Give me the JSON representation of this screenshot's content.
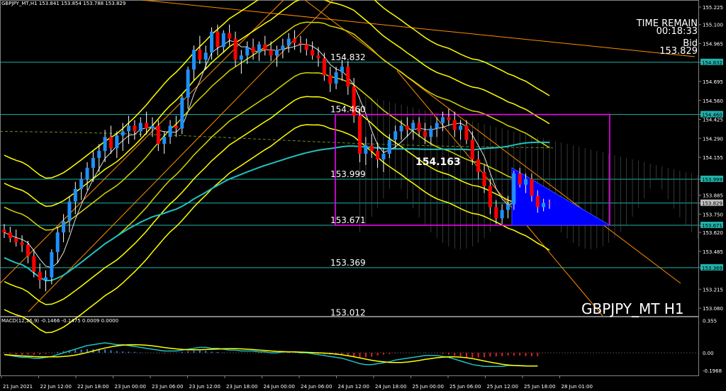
{
  "header": {
    "info": "GBPJPY_MT,H1  153.841 153.854 153.788 153.829",
    "time_remain_label": "TIME REMAIN",
    "time_remain": "00:18:33",
    "bid_label": "Bid",
    "bid": "153.829",
    "symbol": "GBPJPY_MT H1",
    "macd_info": "MACD(12,26,9) -0.1466 -0.1475 0.0009 0.0000",
    "big_label": "154.163"
  },
  "colors": {
    "background": "#000000",
    "bull": "#1e90ff",
    "bear": "#ff0000",
    "band": "#ffff00",
    "ma_cyan": "#20c0c0",
    "trend": "#ff8c00",
    "box": "#ff00ff",
    "triangle": "#0000ff",
    "hline": "#20b2aa"
  },
  "chart_data": {
    "type": "candlestick",
    "title": "GBPJPY_MT H1",
    "ylim": [
      153.0,
      155.25
    ],
    "y_ticks": [
      "155.225",
      "155.100",
      "154.965",
      "154.832",
      "154.695",
      "154.560",
      "154.460",
      "154.425",
      "154.290",
      "154.155",
      "153.999",
      "153.885",
      "153.829",
      "153.750",
      "153.671",
      "153.620",
      "153.485",
      "153.369",
      "153.215",
      "153.080"
    ],
    "x_ticks": [
      "21 Jun 2021",
      "22 Jun 12:00",
      "22 Jun 18:00",
      "23 Jun 00:00",
      "23 Jun 06:00",
      "23 Jun 12:00",
      "23 Jun 18:00",
      "24 Jun 00:00",
      "24 Jun 06:00",
      "24 Jun 12:00",
      "24 Jun 18:00",
      "25 Jun 00:00",
      "25 Jun 06:00",
      "25 Jun 12:00",
      "25 Jun 18:00",
      "28 Jun 01:00"
    ],
    "level_labels": [
      "154.832",
      "154.460",
      "153.999",
      "153.671",
      "153.369",
      "153.012"
    ],
    "highlighted_levels": [
      "154.832",
      "154.460",
      "153.999",
      "153.829",
      "153.671",
      "153.369"
    ],
    "candles": [
      [
        153.64,
        153.68,
        153.58,
        153.62
      ],
      [
        153.62,
        153.66,
        153.55,
        153.58
      ],
      [
        153.58,
        153.64,
        153.52,
        153.55
      ],
      [
        153.55,
        153.6,
        153.48,
        153.53
      ],
      [
        153.53,
        153.56,
        153.4,
        153.45
      ],
      [
        153.45,
        153.5,
        153.3,
        153.34
      ],
      [
        153.34,
        153.4,
        153.22,
        153.28
      ],
      [
        153.28,
        153.35,
        153.2,
        153.3
      ],
      [
        153.3,
        153.5,
        153.25,
        153.48
      ],
      [
        153.48,
        153.66,
        153.4,
        153.62
      ],
      [
        153.62,
        153.75,
        153.55,
        153.7
      ],
      [
        153.7,
        153.88,
        153.62,
        153.84
      ],
      [
        153.84,
        153.98,
        153.75,
        153.93
      ],
      [
        153.93,
        154.05,
        153.85,
        154.0
      ],
      [
        154.0,
        154.12,
        153.92,
        154.08
      ],
      [
        154.08,
        154.2,
        153.98,
        154.15
      ],
      [
        154.15,
        154.25,
        154.05,
        154.2
      ],
      [
        154.2,
        154.35,
        154.12,
        154.3
      ],
      [
        154.3,
        154.38,
        154.18,
        154.22
      ],
      [
        154.22,
        154.34,
        154.15,
        154.31
      ],
      [
        154.31,
        154.4,
        154.2,
        154.34
      ],
      [
        154.34,
        154.45,
        154.25,
        154.38
      ],
      [
        154.38,
        154.42,
        154.28,
        154.34
      ],
      [
        154.34,
        154.44,
        154.3,
        154.4
      ],
      [
        154.4,
        154.48,
        154.32,
        154.36
      ],
      [
        154.36,
        154.44,
        154.3,
        154.38
      ],
      [
        154.38,
        154.42,
        154.2,
        154.25
      ],
      [
        154.25,
        154.34,
        154.18,
        154.3
      ],
      [
        154.3,
        154.42,
        154.25,
        154.38
      ],
      [
        154.38,
        154.45,
        154.3,
        154.36
      ],
      [
        154.36,
        154.6,
        154.32,
        154.58
      ],
      [
        154.58,
        154.8,
        154.5,
        154.78
      ],
      [
        154.78,
        154.95,
        154.7,
        154.92
      ],
      [
        154.92,
        155.02,
        154.82,
        154.85
      ],
      [
        154.85,
        154.95,
        154.78,
        154.9
      ],
      [
        154.9,
        155.08,
        154.85,
        155.05
      ],
      [
        155.05,
        155.1,
        154.88,
        154.94
      ],
      [
        154.94,
        155.06,
        154.9,
        155.04
      ],
      [
        155.04,
        155.1,
        154.95,
        155.0
      ],
      [
        155.0,
        155.05,
        154.8,
        154.85
      ],
      [
        154.85,
        154.92,
        154.75,
        154.88
      ],
      [
        154.88,
        154.98,
        154.82,
        154.94
      ],
      [
        154.94,
        155.0,
        154.85,
        154.9
      ],
      [
        154.9,
        154.98,
        154.84,
        154.96
      ],
      [
        154.96,
        155.02,
        154.88,
        154.92
      ],
      [
        154.92,
        154.98,
        154.84,
        154.88
      ],
      [
        154.88,
        154.95,
        154.8,
        154.92
      ],
      [
        154.92,
        155.0,
        154.86,
        154.95
      ],
      [
        154.95,
        155.04,
        154.9,
        155.0
      ],
      [
        155.0,
        155.06,
        154.92,
        154.97
      ],
      [
        154.97,
        155.02,
        154.9,
        154.96
      ],
      [
        154.96,
        155.0,
        154.88,
        154.92
      ],
      [
        154.92,
        154.98,
        154.85,
        154.88
      ],
      [
        154.88,
        154.94,
        154.8,
        154.86
      ],
      [
        154.86,
        154.9,
        154.7,
        154.74
      ],
      [
        154.74,
        154.8,
        154.62,
        154.68
      ],
      [
        154.68,
        154.8,
        154.64,
        154.76
      ],
      [
        154.76,
        154.85,
        154.7,
        154.8
      ],
      [
        154.8,
        154.84,
        154.6,
        154.66
      ],
      [
        154.66,
        154.72,
        154.4,
        154.45
      ],
      [
        154.45,
        154.5,
        154.12,
        154.18
      ],
      [
        154.18,
        154.3,
        154.1,
        154.24
      ],
      [
        154.24,
        154.32,
        154.15,
        154.2
      ],
      [
        154.2,
        154.26,
        154.08,
        154.14
      ],
      [
        154.14,
        154.22,
        154.05,
        154.18
      ],
      [
        154.18,
        154.32,
        154.15,
        154.28
      ],
      [
        154.28,
        154.38,
        154.22,
        154.34
      ],
      [
        154.34,
        154.42,
        154.28,
        154.38
      ],
      [
        154.38,
        154.44,
        154.3,
        154.35
      ],
      [
        154.35,
        154.42,
        154.28,
        154.4
      ],
      [
        154.4,
        154.44,
        154.3,
        154.34
      ],
      [
        154.34,
        154.4,
        154.25,
        154.3
      ],
      [
        154.3,
        154.38,
        154.24,
        154.36
      ],
      [
        154.36,
        154.44,
        154.3,
        154.4
      ],
      [
        154.4,
        154.48,
        154.34,
        154.44
      ],
      [
        154.44,
        154.5,
        154.38,
        154.42
      ],
      [
        154.42,
        154.48,
        154.3,
        154.35
      ],
      [
        154.35,
        154.42,
        154.28,
        154.38
      ],
      [
        154.38,
        154.42,
        154.25,
        154.28
      ],
      [
        154.28,
        154.34,
        154.1,
        154.14
      ],
      [
        154.14,
        154.2,
        154.0,
        154.05
      ],
      [
        154.05,
        154.1,
        153.9,
        153.95
      ],
      [
        153.95,
        154.0,
        153.75,
        153.8
      ],
      [
        153.8,
        153.85,
        153.68,
        153.72
      ],
      [
        153.72,
        153.82,
        153.68,
        153.78
      ],
      [
        153.78,
        153.88,
        153.72,
        153.82
      ],
      [
        153.82,
        154.06,
        153.78,
        154.04
      ],
      [
        154.04,
        154.08,
        153.94,
        153.96
      ],
      [
        153.96,
        154.04,
        153.9,
        154.0
      ],
      [
        154.0,
        154.04,
        153.84,
        153.88
      ],
      [
        153.88,
        153.92,
        153.76,
        153.8
      ],
      [
        153.8,
        153.86,
        153.77,
        153.83
      ],
      [
        153.83,
        153.854,
        153.788,
        153.829
      ]
    ],
    "macd": {
      "label": "MACD(12,26,9)",
      "ylim": [
        -0.25,
        0.4
      ],
      "y_ticks": [
        "0.355",
        "0.00",
        "-0.1968"
      ],
      "values": [
        -0.02,
        -0.03,
        -0.04,
        -0.05,
        -0.05,
        -0.06,
        -0.06,
        -0.05,
        -0.04,
        -0.02,
        0.0,
        0.02,
        0.04,
        0.06,
        0.08,
        0.09,
        0.1,
        0.11,
        0.1,
        0.09,
        0.09,
        0.08,
        0.07,
        0.06,
        0.05,
        0.04,
        0.03,
        0.02,
        0.02,
        0.02,
        0.03,
        0.04,
        0.05,
        0.06,
        0.06,
        0.05,
        0.05,
        0.04,
        0.03,
        0.03,
        0.02,
        0.02,
        0.02,
        0.01,
        0.01,
        0.0,
        0.0,
        0.01,
        0.01,
        0.01,
        0.0,
        0.0,
        -0.01,
        -0.02,
        -0.03,
        -0.04,
        -0.05,
        -0.06,
        -0.08,
        -0.1,
        -0.12,
        -0.13,
        -0.13,
        -0.12,
        -0.11,
        -0.1,
        -0.08,
        -0.07,
        -0.06,
        -0.05,
        -0.04,
        -0.03,
        -0.03,
        -0.03,
        -0.04,
        -0.05,
        -0.07,
        -0.09,
        -0.11,
        -0.13,
        -0.14,
        -0.15,
        -0.15,
        -0.15,
        -0.15,
        -0.14,
        -0.14,
        -0.14,
        -0.145,
        -0.146,
        -0.147
      ]
    }
  }
}
